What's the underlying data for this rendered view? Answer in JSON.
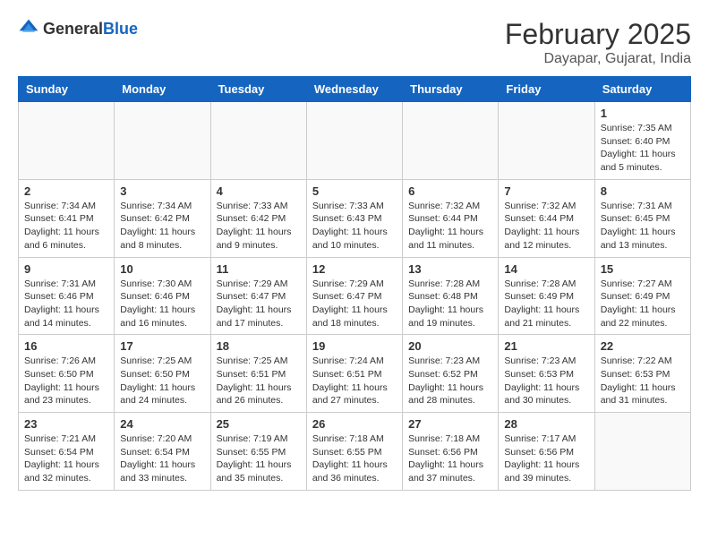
{
  "header": {
    "logo": {
      "general": "General",
      "blue": "Blue"
    },
    "title": "February 2025",
    "location": "Dayapar, Gujarat, India"
  },
  "days_of_week": [
    "Sunday",
    "Monday",
    "Tuesday",
    "Wednesday",
    "Thursday",
    "Friday",
    "Saturday"
  ],
  "weeks": [
    [
      {
        "day": "",
        "info": ""
      },
      {
        "day": "",
        "info": ""
      },
      {
        "day": "",
        "info": ""
      },
      {
        "day": "",
        "info": ""
      },
      {
        "day": "",
        "info": ""
      },
      {
        "day": "",
        "info": ""
      },
      {
        "day": "1",
        "info": "Sunrise: 7:35 AM\nSunset: 6:40 PM\nDaylight: 11 hours and 5 minutes."
      }
    ],
    [
      {
        "day": "2",
        "info": "Sunrise: 7:34 AM\nSunset: 6:41 PM\nDaylight: 11 hours and 6 minutes."
      },
      {
        "day": "3",
        "info": "Sunrise: 7:34 AM\nSunset: 6:42 PM\nDaylight: 11 hours and 8 minutes."
      },
      {
        "day": "4",
        "info": "Sunrise: 7:33 AM\nSunset: 6:42 PM\nDaylight: 11 hours and 9 minutes."
      },
      {
        "day": "5",
        "info": "Sunrise: 7:33 AM\nSunset: 6:43 PM\nDaylight: 11 hours and 10 minutes."
      },
      {
        "day": "6",
        "info": "Sunrise: 7:32 AM\nSunset: 6:44 PM\nDaylight: 11 hours and 11 minutes."
      },
      {
        "day": "7",
        "info": "Sunrise: 7:32 AM\nSunset: 6:44 PM\nDaylight: 11 hours and 12 minutes."
      },
      {
        "day": "8",
        "info": "Sunrise: 7:31 AM\nSunset: 6:45 PM\nDaylight: 11 hours and 13 minutes."
      }
    ],
    [
      {
        "day": "9",
        "info": "Sunrise: 7:31 AM\nSunset: 6:46 PM\nDaylight: 11 hours and 14 minutes."
      },
      {
        "day": "10",
        "info": "Sunrise: 7:30 AM\nSunset: 6:46 PM\nDaylight: 11 hours and 16 minutes."
      },
      {
        "day": "11",
        "info": "Sunrise: 7:29 AM\nSunset: 6:47 PM\nDaylight: 11 hours and 17 minutes."
      },
      {
        "day": "12",
        "info": "Sunrise: 7:29 AM\nSunset: 6:47 PM\nDaylight: 11 hours and 18 minutes."
      },
      {
        "day": "13",
        "info": "Sunrise: 7:28 AM\nSunset: 6:48 PM\nDaylight: 11 hours and 19 minutes."
      },
      {
        "day": "14",
        "info": "Sunrise: 7:28 AM\nSunset: 6:49 PM\nDaylight: 11 hours and 21 minutes."
      },
      {
        "day": "15",
        "info": "Sunrise: 7:27 AM\nSunset: 6:49 PM\nDaylight: 11 hours and 22 minutes."
      }
    ],
    [
      {
        "day": "16",
        "info": "Sunrise: 7:26 AM\nSunset: 6:50 PM\nDaylight: 11 hours and 23 minutes."
      },
      {
        "day": "17",
        "info": "Sunrise: 7:25 AM\nSunset: 6:50 PM\nDaylight: 11 hours and 24 minutes."
      },
      {
        "day": "18",
        "info": "Sunrise: 7:25 AM\nSunset: 6:51 PM\nDaylight: 11 hours and 26 minutes."
      },
      {
        "day": "19",
        "info": "Sunrise: 7:24 AM\nSunset: 6:51 PM\nDaylight: 11 hours and 27 minutes."
      },
      {
        "day": "20",
        "info": "Sunrise: 7:23 AM\nSunset: 6:52 PM\nDaylight: 11 hours and 28 minutes."
      },
      {
        "day": "21",
        "info": "Sunrise: 7:23 AM\nSunset: 6:53 PM\nDaylight: 11 hours and 30 minutes."
      },
      {
        "day": "22",
        "info": "Sunrise: 7:22 AM\nSunset: 6:53 PM\nDaylight: 11 hours and 31 minutes."
      }
    ],
    [
      {
        "day": "23",
        "info": "Sunrise: 7:21 AM\nSunset: 6:54 PM\nDaylight: 11 hours and 32 minutes."
      },
      {
        "day": "24",
        "info": "Sunrise: 7:20 AM\nSunset: 6:54 PM\nDaylight: 11 hours and 33 minutes."
      },
      {
        "day": "25",
        "info": "Sunrise: 7:19 AM\nSunset: 6:55 PM\nDaylight: 11 hours and 35 minutes."
      },
      {
        "day": "26",
        "info": "Sunrise: 7:18 AM\nSunset: 6:55 PM\nDaylight: 11 hours and 36 minutes."
      },
      {
        "day": "27",
        "info": "Sunrise: 7:18 AM\nSunset: 6:56 PM\nDaylight: 11 hours and 37 minutes."
      },
      {
        "day": "28",
        "info": "Sunrise: 7:17 AM\nSunset: 6:56 PM\nDaylight: 11 hours and 39 minutes."
      },
      {
        "day": "",
        "info": ""
      }
    ]
  ]
}
